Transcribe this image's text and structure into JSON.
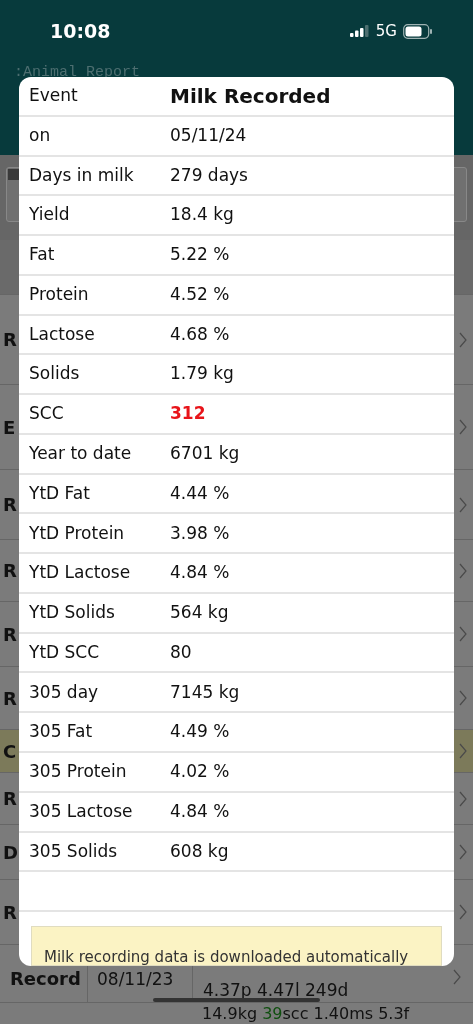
{
  "status_bar": {
    "time": "10:08",
    "network": "5G"
  },
  "header": {
    "title": ":Animal Report"
  },
  "list": [
    {
      "label": "R",
      "highlighted": false
    },
    {
      "label": "E",
      "highlighted": false
    },
    {
      "label": "R",
      "highlighted": false
    },
    {
      "label": "R",
      "highlighted": false
    },
    {
      "label": "R",
      "highlighted": false
    },
    {
      "label": "R",
      "highlighted": false
    },
    {
      "label": "C",
      "highlighted": true
    },
    {
      "label": "R",
      "highlighted": false
    },
    {
      "label": "D",
      "highlighted": false
    },
    {
      "label": "R",
      "highlighted": false
    }
  ],
  "record_row": {
    "label": "Record",
    "date": "08/11/23",
    "lines": [
      [
        {
          "text": "4.37p 4.47l 249d"
        }
      ],
      [
        {
          "text": "14.9kg "
        },
        {
          "text": "39",
          "color": "#0f4f0f"
        },
        {
          "text": "scc 1.40ms 5.3f"
        }
      ]
    ]
  },
  "dialog": {
    "title_label": "Event",
    "title": "Milk Recorded",
    "rows": [
      {
        "label": "on",
        "value": "05/11/24",
        "alert": false
      },
      {
        "label": "Days in milk",
        "value": "279 days",
        "alert": false
      },
      {
        "label": "Yield",
        "value": "18.4 kg",
        "alert": false
      },
      {
        "label": "Fat",
        "value": "5.22 %",
        "alert": false
      },
      {
        "label": "Protein",
        "value": "4.52 %",
        "alert": false
      },
      {
        "label": "Lactose",
        "value": "4.68 %",
        "alert": false
      },
      {
        "label": "Solids",
        "value": "1.79 kg",
        "alert": false
      },
      {
        "label": "SCC",
        "value": "312",
        "alert": true
      },
      {
        "label": "Year to date",
        "value": "6701 kg",
        "alert": false
      },
      {
        "label": "YtD Fat",
        "value": "4.44 %",
        "alert": false
      },
      {
        "label": "YtD Protein",
        "value": "3.98 %",
        "alert": false
      },
      {
        "label": "YtD Lactose",
        "value": "4.84 %",
        "alert": false
      },
      {
        "label": "YtD Solids",
        "value": "564 kg",
        "alert": false
      },
      {
        "label": "YtD SCC",
        "value": "80",
        "alert": false
      },
      {
        "label": "305 day",
        "value": "7145 kg",
        "alert": false
      },
      {
        "label": "305 Fat",
        "value": "4.49 %",
        "alert": false
      },
      {
        "label": "305 Protein",
        "value": "4.02 %",
        "alert": false
      },
      {
        "label": "305 Lactose",
        "value": "4.84 %",
        "alert": false
      },
      {
        "label": "305 Solids",
        "value": "608 kg",
        "alert": false
      }
    ],
    "note": "Milk recording data is downloaded automatically"
  }
}
